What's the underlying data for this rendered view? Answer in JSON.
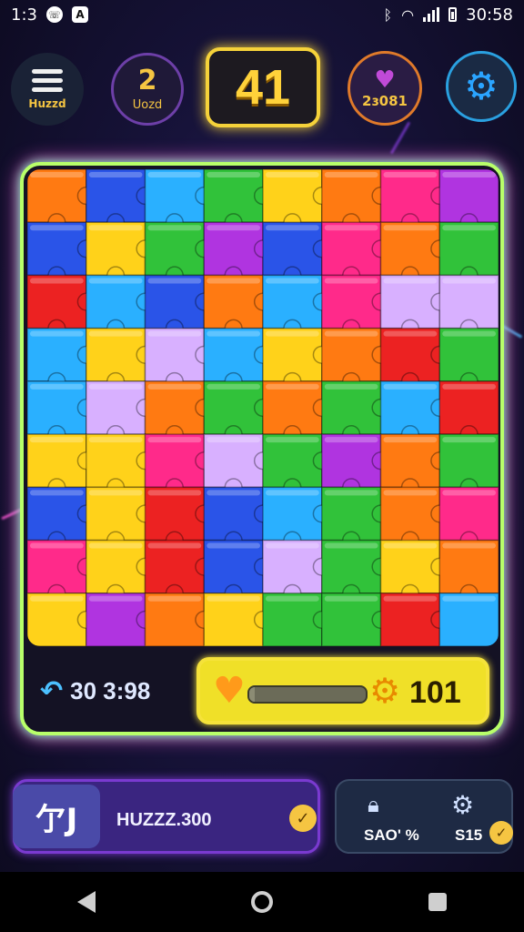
{
  "status_bar": {
    "time": "1:3",
    "icon_1": "whatsapp-icon",
    "icon_2_text": "A",
    "clock": "30:58"
  },
  "hud": {
    "menu_label": "Huzzd",
    "level_number": "2",
    "level_label": "Uozd",
    "score": "41",
    "hearts_value": "2ɜ081",
    "settings_icon": "gear-icon"
  },
  "board": {
    "rows": 9,
    "cols": 8,
    "palette": [
      "#ff2a8a",
      "#2ab0ff",
      "#31c23a",
      "#ffd21a",
      "#ff7a12",
      "#2a54e8",
      "#ec2222",
      "#b034e0",
      "#d8b0ff"
    ]
  },
  "progress": {
    "timer_text": "30 3:98",
    "life_fill_fraction": 0.05,
    "coins": "101"
  },
  "bottom_bar": {
    "hint_icon_text": "亇J",
    "hint_text": "HUZZZ.300",
    "shop_label_1": "SAO' %",
    "shop_label_2": "S15"
  },
  "colors": {
    "accent_yellow": "#f5d23a",
    "neon_green": "#b8ff6a",
    "neon_pink": "#ff5ad8",
    "purple": "#7a3ad0"
  }
}
